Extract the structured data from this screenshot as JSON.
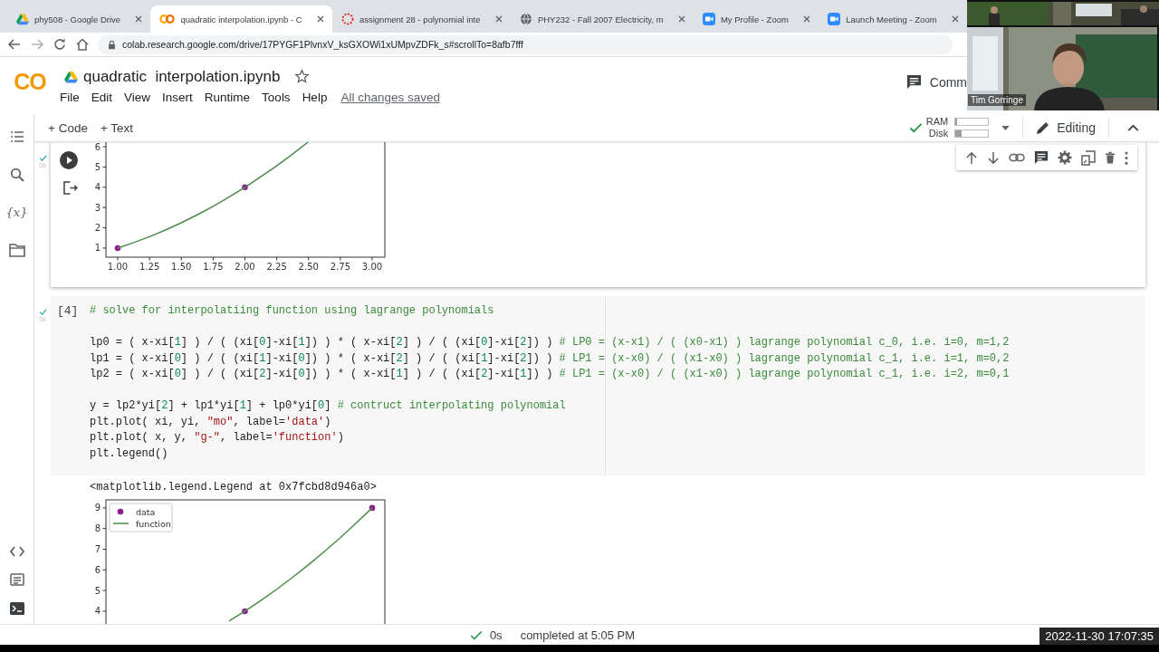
{
  "browser": {
    "tabs": [
      {
        "title": "phy508 - Google Drive",
        "kind": "drive",
        "selected": false
      },
      {
        "title": "quadratic interpolation.ipynb - C",
        "kind": "colab",
        "selected": true
      },
      {
        "title": "assignment 28 - polynomial inte",
        "kind": "loading",
        "selected": false
      },
      {
        "title": "PHY232 - Fall 2007 Electricity, m",
        "kind": "globe",
        "selected": false
      },
      {
        "title": "My Profile - Zoom",
        "kind": "zoom",
        "selected": false
      },
      {
        "title": "Launch Meeting - Zoom",
        "kind": "zoom",
        "selected": false
      }
    ],
    "address": "colab.research.google.com/drive/17PYGF1PlvnxV_ksGXOWi1xUMpvZDFk_s#scrollTo=8afb7fff"
  },
  "video": {
    "kind": "picture",
    "participant": "Tim Gorringe"
  },
  "notebook": {
    "logo": "CO",
    "title": "quadratic  interpolation.ipynb",
    "menu": [
      "File",
      "Edit",
      "View",
      "Insert",
      "Runtime",
      "Tools",
      "Help"
    ],
    "save_status": "All changes saved",
    "comments_button": "Comm"
  },
  "toolbar": {
    "add_buttons": [
      "+ Code",
      "+ Text"
    ],
    "meters": [
      {
        "label": "RAM",
        "level": 0.05
      },
      {
        "label": "Disk",
        "level": 0.2
      }
    ],
    "mode": "Editing"
  },
  "sidebar": {
    "items": [
      {
        "kind": "toc"
      },
      {
        "kind": "search"
      },
      {
        "kind": "variables",
        "glyph": "{x}"
      },
      {
        "kind": "files"
      },
      {
        "kind": "snippets"
      },
      {
        "kind": "palette"
      },
      {
        "kind": "terminal"
      }
    ]
  },
  "cell_toolbar": [
    {
      "kind": "move-up"
    },
    {
      "kind": "move-down"
    },
    {
      "kind": "link"
    },
    {
      "kind": "comment"
    },
    {
      "kind": "settings"
    },
    {
      "kind": "mirror"
    },
    {
      "kind": "delete"
    },
    {
      "kind": "more"
    }
  ],
  "cells": [
    {
      "kind": "output",
      "exec_time": "0s",
      "chart_data": {
        "type": "line",
        "x": [
          1,
          1.125,
          1.25,
          1.375,
          1.5,
          1.625,
          1.75,
          1.875,
          2,
          2.125,
          2.25,
          2.375,
          2.5
        ],
        "series": [
          {
            "type": "scatter",
            "color": "#8e1f8e",
            "values": [
              1,
              null,
              null,
              null,
              null,
              null,
              null,
              null,
              4,
              null,
              null,
              null,
              null
            ]
          },
          {
            "type": "line",
            "color": "#4b8b4b",
            "values": [
              1,
              1.27,
              1.56,
              1.89,
              2.25,
              2.64,
              3.06,
              3.52,
              4,
              4.52,
              5.06,
              5.64,
              6.25
            ]
          }
        ],
        "xlim": [
          0.9075,
          3.0996
        ],
        "ylim": [
          0.55,
          6.36
        ],
        "xticks": [
          {
            "value": 1,
            "label": "1.00"
          },
          {
            "value": 1.25,
            "label": "1.25"
          },
          {
            "value": 1.5,
            "label": "1.50"
          },
          {
            "value": 1.75,
            "label": "1.75"
          },
          {
            "value": 2,
            "label": "2.00"
          },
          {
            "value": 2.25,
            "label": "2.25"
          },
          {
            "value": 2.5,
            "label": "2.50"
          },
          {
            "value": 2.75,
            "label": "2.75"
          },
          {
            "value": 3,
            "label": "3.00"
          }
        ],
        "yticks": [
          1,
          2,
          3,
          4,
          5,
          6
        ]
      }
    },
    {
      "kind": "code",
      "exec_count": "[4]",
      "exec_time": "0s",
      "code_blocks": [
        [
          "# solve for interpolatiing function using lagrange polynomials"
        ],
        [
          "lp0 = ( x-xi[1] ) / ( (xi[0]-xi[1]) ) * ( x-xi[2] ) / ( (xi[0]-xi[2]) ) # LP0 = (x-x1) / ( (x0-x1) ) lagrange polynomial c_0, i.e. i=0, m=1,2",
          "lp1 = ( x-xi[0] ) / ( (xi[1]-xi[0]) ) * ( x-xi[2] ) / ( (xi[1]-xi[2]) ) # LP1 = (x-x0) / ( (x1-x0) ) lagrange polynomial c_1, i.e. i=1, m=0,2",
          "lp2 = ( x-xi[0] ) / ( (xi[2]-xi[0]) ) * ( x-xi[1] ) / ( (xi[2]-xi[1]) ) # LP1 = (x-x0) / ( (x1-x0) ) lagrange polynomial c_1, i.e. i=2, m=0,1"
        ],
        [
          "y = lp2*yi[2] + lp1*yi[1] + lp0*yi[0] # contruct interpolating polynomial",
          "plt.plot( xi, yi, \"mo\", label='data')",
          "plt.plot( x, y, \"g-\", label='function')",
          "plt.legend()"
        ]
      ],
      "output_text": "<matplotlib.legend.Legend at 0x7fcbd8d946a0>",
      "chart_data": {
        "type": "line",
        "legend": true,
        "x": [
          1.875,
          2,
          2.125,
          2.25,
          2.375,
          2.5,
          2.625,
          2.75,
          2.875,
          3
        ],
        "series": [
          {
            "name": "data",
            "type": "scatter",
            "color": "#8e1f8e",
            "values": [
              null,
              4,
              null,
              null,
              null,
              null,
              null,
              null,
              null,
              9
            ]
          },
          {
            "name": "function",
            "type": "line",
            "color": "#4b8b4b",
            "values": [
              3.52,
              4,
              4.52,
              5.06,
              5.64,
              6.25,
              6.89,
              7.56,
              8.27,
              9
            ]
          }
        ],
        "xlim": [
          0.9075,
          3.0996
        ],
        "ylim": [
          3.12,
          9.39
        ],
        "yticks": [
          4,
          5,
          6,
          7,
          8,
          9
        ]
      }
    }
  ],
  "status_bar": {
    "duration": "0s",
    "message": "completed at 5:05 PM"
  },
  "recording_timestamp": "2022-11-30 17:07:35"
}
